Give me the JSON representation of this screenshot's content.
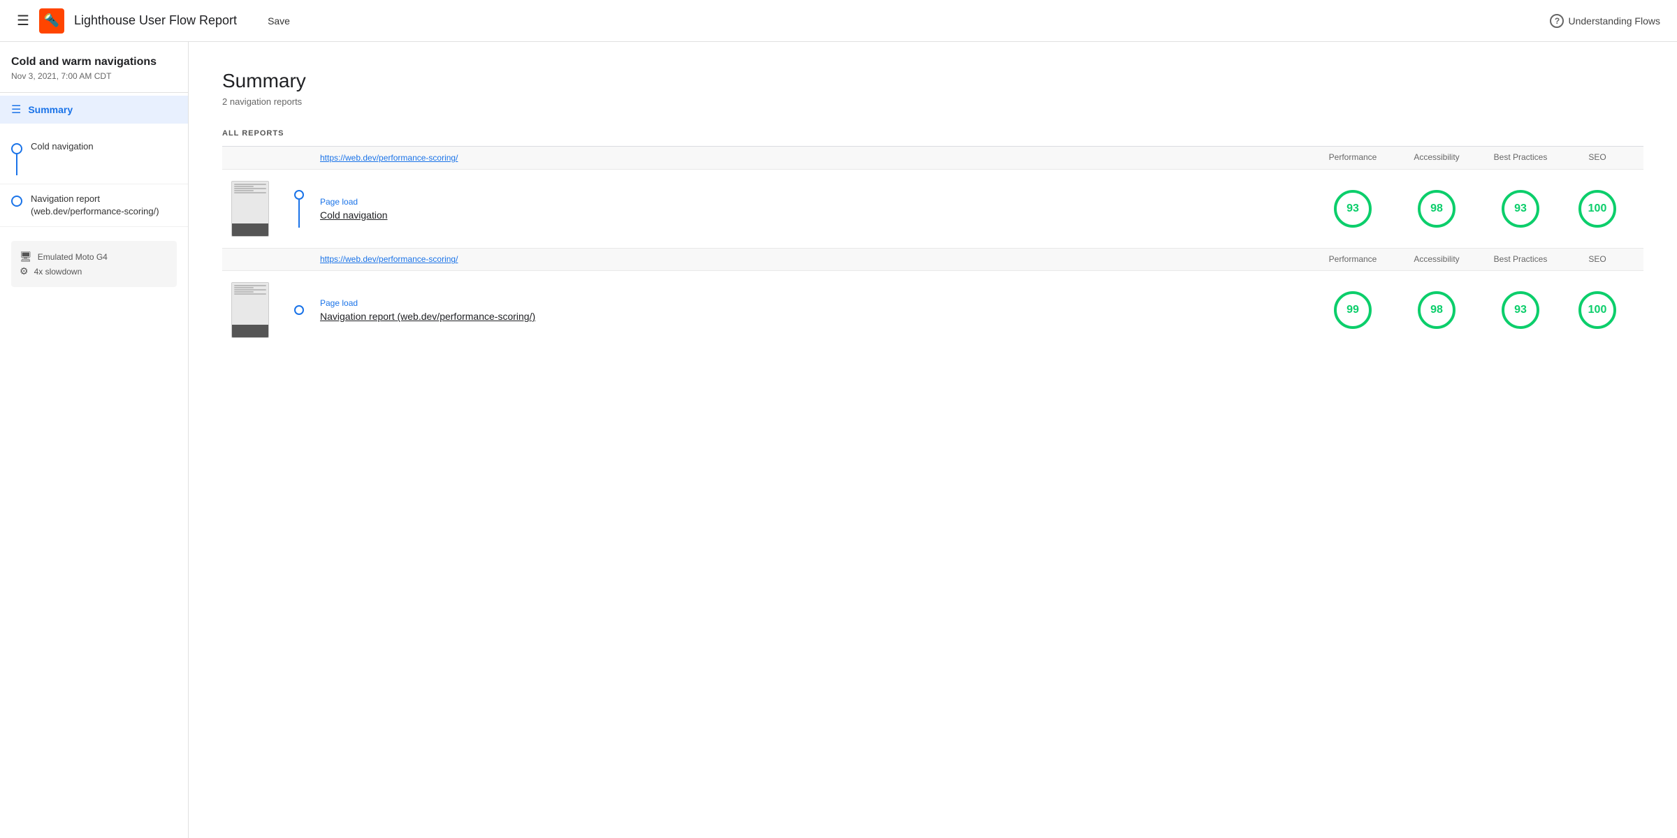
{
  "header": {
    "menu_icon": "☰",
    "logo_icon": "🔦",
    "title": "Lighthouse User Flow Report",
    "save_label": "Save",
    "understanding_flows_label": "Understanding Flows"
  },
  "sidebar": {
    "project_name": "Cold and warm navigations",
    "project_date": "Nov 3, 2021, 7:00 AM CDT",
    "summary_label": "Summary",
    "nav_items": [
      {
        "label": "Cold navigation"
      },
      {
        "label": "Navigation report (web.dev/performance-scoring/)"
      }
    ],
    "device": "Emulated Moto G4",
    "throttle": "4x slowdown"
  },
  "main": {
    "summary_title": "Summary",
    "summary_sub": "2 navigation reports",
    "all_reports_label": "ALL REPORTS",
    "reports": [
      {
        "url": "https://web.dev/performance-scoring/",
        "page_load_label": "Page load",
        "name": "Cold navigation",
        "scores": {
          "performance": 93,
          "accessibility": 98,
          "best_practices": 93,
          "seo": 100
        }
      },
      {
        "url": "https://web.dev/performance-scoring/",
        "page_load_label": "Page load",
        "name": "Navigation report (web.dev/performance-scoring/)",
        "scores": {
          "performance": 99,
          "accessibility": 98,
          "best_practices": 93,
          "seo": 100
        }
      }
    ],
    "col_headers": {
      "performance": "Performance",
      "accessibility": "Accessibility",
      "best_practices": "Best Practices",
      "seo": "SEO"
    }
  }
}
